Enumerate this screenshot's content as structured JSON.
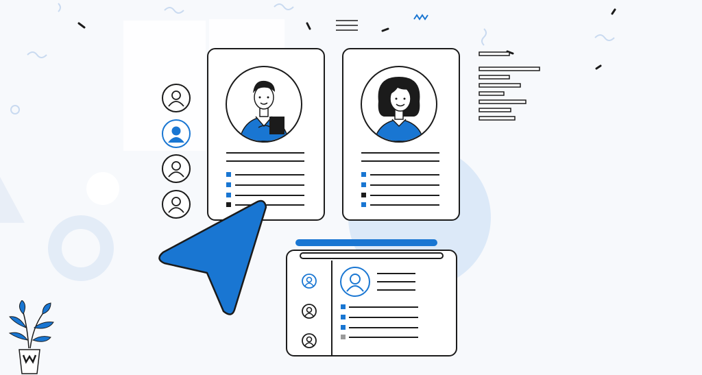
{
  "colors": {
    "accent": "#1976d2",
    "accent_light": "#dce9f8",
    "ink": "#1b1b1b",
    "background": "#f7f9fc",
    "card": "#ffffff",
    "grey": "#9a9a9a"
  },
  "icons": [
    "user-avatar-icon",
    "selected-user-avatar-icon",
    "cursor-pointer-icon",
    "potted-plant-icon",
    "hamburger-lines-icon"
  ],
  "profile_cards": [
    {
      "person": "man-with-tablet",
      "bullet_colors": [
        "blue",
        "blue",
        "blue",
        "black"
      ]
    },
    {
      "person": "woman-smiling",
      "bullet_colors": [
        "blue",
        "blue",
        "black",
        "blue"
      ]
    }
  ],
  "side_avatars": [
    {
      "state": "default"
    },
    {
      "state": "selected"
    },
    {
      "state": "default"
    },
    {
      "state": "default"
    }
  ],
  "bottom_panel": {
    "sidebar_avatars": [
      "selected",
      "default",
      "default"
    ],
    "bullet_colors": [
      "blue",
      "blue",
      "blue",
      "grey"
    ]
  }
}
